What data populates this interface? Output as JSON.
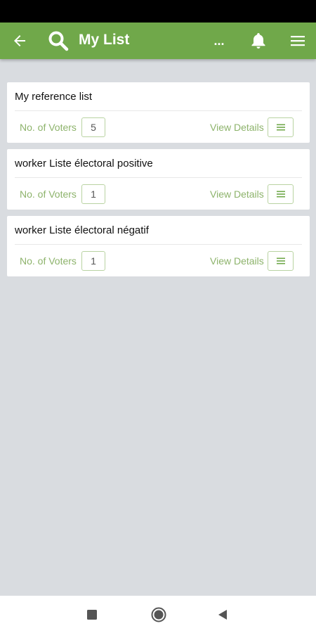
{
  "header": {
    "title": "My List",
    "more_label": "...",
    "color": "#70a84a"
  },
  "icons": {
    "back": "arrow-left-icon",
    "search": "search-icon",
    "notifications": "bell-icon",
    "menu": "hamburger-menu-icon"
  },
  "lists": [
    {
      "name": "My reference list",
      "voters_label": "No. of Voters",
      "voters_count": "5",
      "details_label": "View Details"
    },
    {
      "name": "worker Liste électoral positive",
      "voters_label": "No. of Voters",
      "voters_count": "1",
      "details_label": "View Details"
    },
    {
      "name": "worker Liste électoral négatif",
      "voters_label": "No. of Voters",
      "voters_count": "1",
      "details_label": "View Details"
    }
  ]
}
